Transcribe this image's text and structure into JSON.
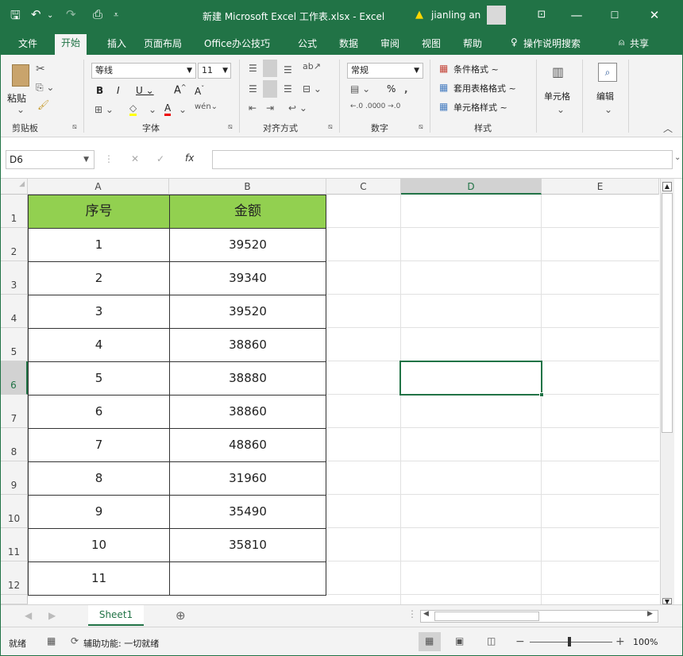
{
  "title_bar": {
    "doc_title": "新建 Microsoft Excel 工作表.xlsx  -  Excel",
    "user": "jianling an",
    "warning_icon": "warning-icon"
  },
  "tabs": [
    "文件",
    "开始",
    "插入",
    "页面布局",
    "Office办公技巧",
    "公式",
    "数据",
    "审阅",
    "视图",
    "帮助"
  ],
  "active_tab": "开始",
  "tell_me": "操作说明搜索",
  "share": "共享",
  "ribbon": {
    "clipboard": {
      "paste": "粘贴",
      "label": "剪贴板"
    },
    "font": {
      "name": "等线",
      "size": "11",
      "label": "字体"
    },
    "alignment": {
      "label": "对齐方式"
    },
    "number": {
      "format": "常规",
      "percent": "%",
      "label": "数字"
    },
    "styles": {
      "conditional": "条件格式 ~",
      "table": "套用表格格式 ~",
      "cell": "单元格样式 ~",
      "label": "样式"
    },
    "cells": {
      "label": "单元格"
    },
    "editing": {
      "label": "编辑"
    }
  },
  "formula_bar": {
    "name_box": "D6",
    "fx": "fx",
    "value": ""
  },
  "columns": [
    "A",
    "B",
    "C",
    "D",
    "E"
  ],
  "rows": [
    "1",
    "2",
    "3",
    "4",
    "5",
    "6",
    "7",
    "8",
    "9",
    "10",
    "11",
    "12"
  ],
  "table": {
    "headers": [
      "序号",
      "金额"
    ],
    "data": [
      [
        "1",
        "39520"
      ],
      [
        "2",
        "39340"
      ],
      [
        "3",
        "39520"
      ],
      [
        "4",
        "38860"
      ],
      [
        "5",
        "38880"
      ],
      [
        "6",
        "38860"
      ],
      [
        "7",
        "48860"
      ],
      [
        "8",
        "31960"
      ],
      [
        "9",
        "35490"
      ],
      [
        "10",
        "35810"
      ],
      [
        "11",
        ""
      ]
    ]
  },
  "header_color": "#92d050",
  "accent": "#217346",
  "selected_cell": "D6",
  "sheet_tab": "Sheet1",
  "status": {
    "ready": "就绪",
    "accessibility": "辅助功能: 一切就绪",
    "zoom": "100%"
  }
}
